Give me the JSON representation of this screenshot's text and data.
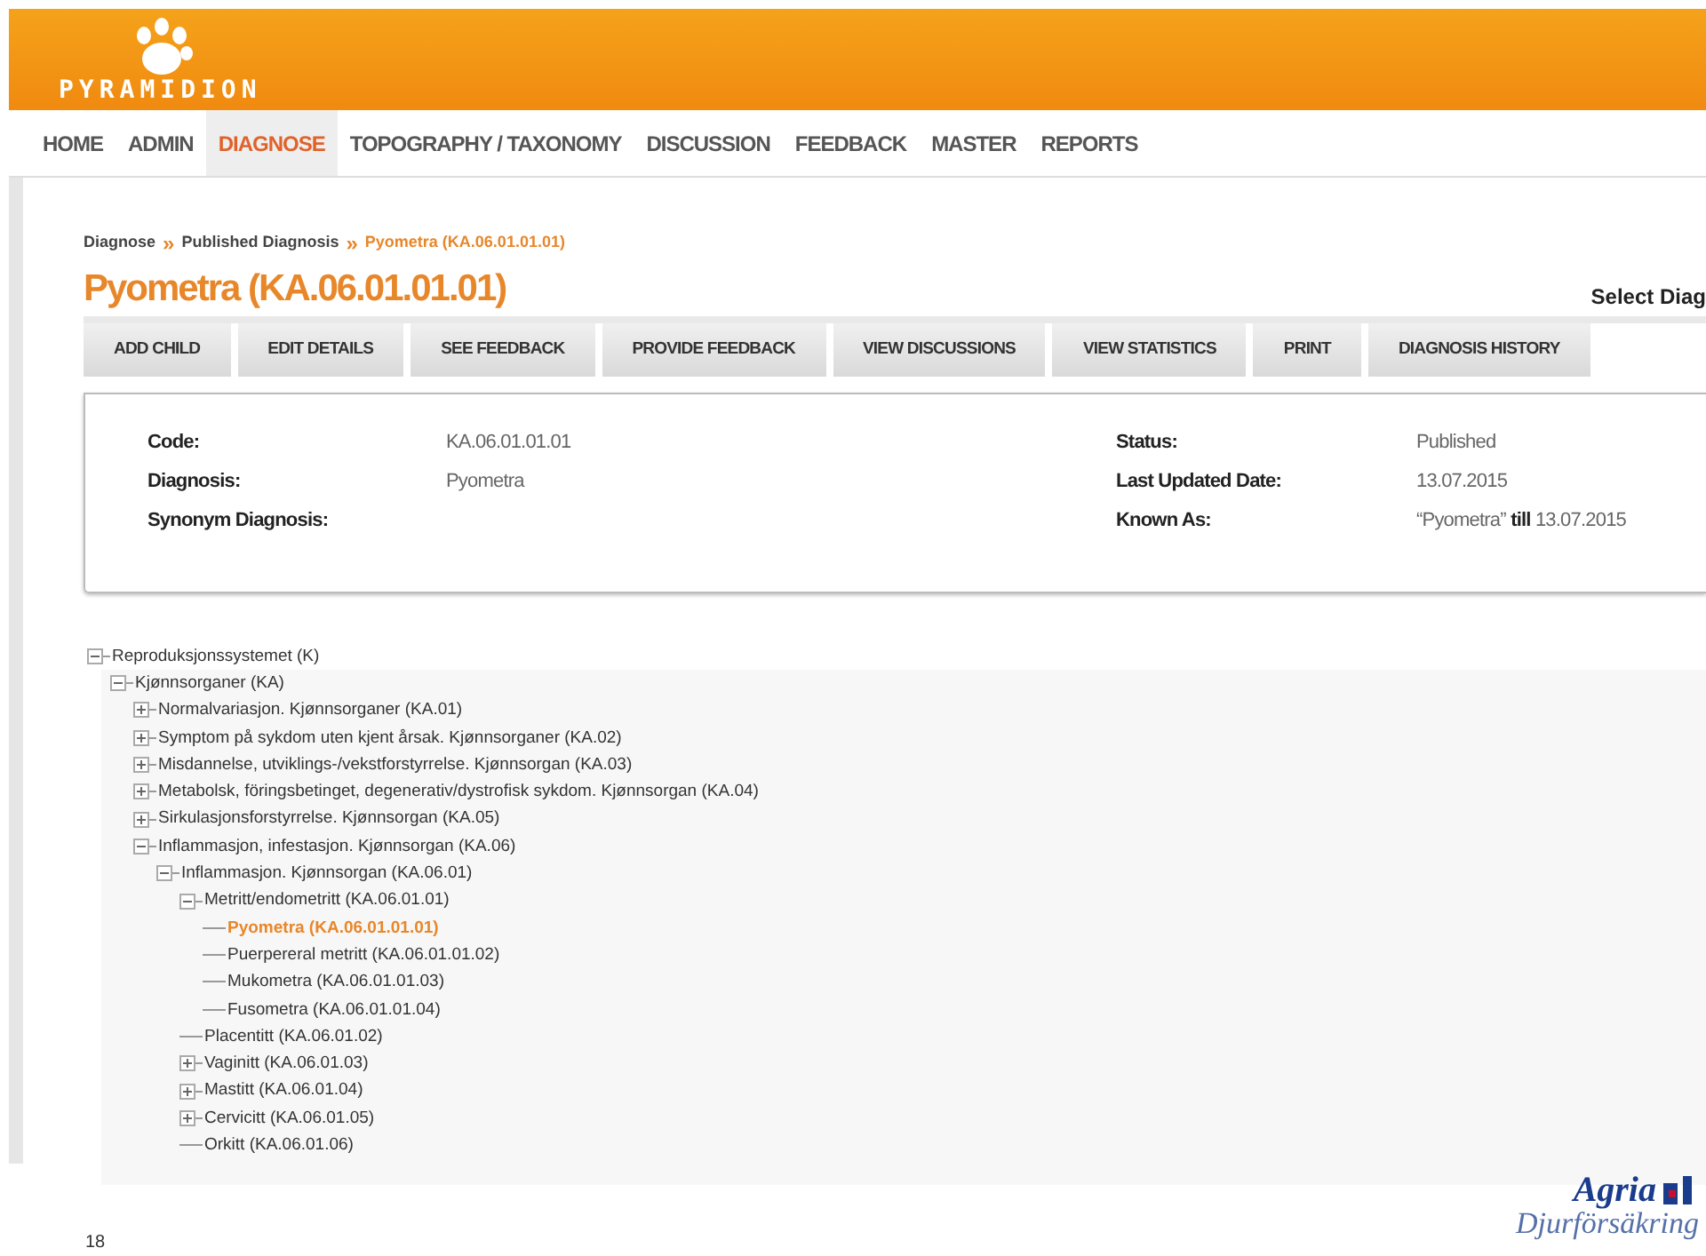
{
  "header": {
    "logo_text": "PYRAMIDION"
  },
  "nav": [
    {
      "label": "HOME",
      "selected": false
    },
    {
      "label": "ADMIN",
      "selected": false
    },
    {
      "label": "DIAGNOSE",
      "selected": true
    },
    {
      "label": "TOPOGRAPHY / TAXONOMY",
      "selected": false
    },
    {
      "label": "DISCUSSION",
      "selected": false
    },
    {
      "label": "FEEDBACK",
      "selected": false
    },
    {
      "label": "MASTER",
      "selected": false
    },
    {
      "label": "REPORTS",
      "selected": false
    }
  ],
  "breadcrumb": [
    {
      "label": "Diagnose",
      "selected": false
    },
    {
      "label": "Published Diagnosis",
      "selected": false
    },
    {
      "label": "Pyometra (KA.06.01.01.01)",
      "selected": true
    }
  ],
  "breadcrumb_separator": "»",
  "title": "Pyometra (KA.06.01.01.01)",
  "select_label": "Select Diag",
  "actions": [
    "ADD CHILD",
    "EDIT DETAILS",
    "SEE FEEDBACK",
    "PROVIDE FEEDBACK",
    "VIEW DISCUSSIONS",
    "VIEW STATISTICS",
    "PRINT",
    "DIAGNOSIS HISTORY"
  ],
  "details_left": [
    {
      "label": "Code:",
      "value": "KA.06.01.01.01"
    },
    {
      "label": "Diagnosis:",
      "value": "Pyometra"
    },
    {
      "label": "Synonym Diagnosis:"
    }
  ],
  "details_right": [
    {
      "label": "Status:",
      "value": "Published"
    },
    {
      "label": "Last Updated Date:",
      "value": "13.07.2015"
    },
    {
      "label": "Known As:",
      "value": "“Pyometra” **till** 13.07.2015"
    }
  ],
  "tree": [
    {
      "label": "Reproduksjonssystemet (K)",
      "kind": "branch",
      "expanded": true,
      "selected": false,
      "children": [
        {
          "label": "Kjønnsorganer (KA)",
          "kind": "branch",
          "expanded": true,
          "selected": false,
          "children": [
            {
              "label": "Normalvariasjon. Kjønnsorganer (KA.01)",
              "kind": "branch",
              "expanded": false,
              "selected": false
            },
            {
              "label": "Symptom på sykdom uten kjent årsak. Kjønnsorganer (KA.02)",
              "kind": "branch",
              "expanded": false,
              "selected": false
            },
            {
              "label": "Misdannelse, utviklings-/vekstforstyrrelse. Kjønnsorgan (KA.03)",
              "kind": "branch",
              "expanded": false,
              "selected": false
            },
            {
              "label": "Metabolsk, föringsbetinget, degenerativ/dystrofisk sykdom. Kjønnsorgan (KA.04)",
              "kind": "branch",
              "expanded": false,
              "selected": false
            },
            {
              "label": "Sirkulasjonsforstyrrelse. Kjønnsorgan (KA.05)",
              "kind": "branch",
              "expanded": false,
              "selected": false
            },
            {
              "label": "Inflammasjon, infestasjon. Kjønnsorgan (KA.06)",
              "kind": "branch",
              "expanded": true,
              "selected": false,
              "children": [
                {
                  "label": "Inflammasjon. Kjønnsorgan (KA.06.01)",
                  "kind": "branch",
                  "expanded": true,
                  "selected": false,
                  "children": [
                    {
                      "label": "Metritt/endometritt (KA.06.01.01)",
                      "kind": "branch",
                      "expanded": true,
                      "selected": false,
                      "children": [
                        {
                          "label": "Pyometra (KA.06.01.01.01)",
                          "kind": "leaf",
                          "selected": true
                        },
                        {
                          "label": "Puerpereral metritt (KA.06.01.01.02)",
                          "kind": "leaf",
                          "selected": false
                        },
                        {
                          "label": "Mukometra (KA.06.01.01.03)",
                          "kind": "leaf",
                          "selected": false
                        },
                        {
                          "label": "Fusometra (KA.06.01.01.04)",
                          "kind": "leaf",
                          "selected": false
                        }
                      ]
                    },
                    {
                      "label": "Placentitt (KA.06.01.02)",
                      "kind": "leaf",
                      "selected": false
                    },
                    {
                      "label": "Vaginitt (KA.06.01.03)",
                      "kind": "branch",
                      "expanded": false,
                      "selected": false
                    },
                    {
                      "label": "Mastitt (KA.06.01.04)",
                      "kind": "branch",
                      "expanded": false,
                      "selected": false
                    },
                    {
                      "label": "Cervicitt (KA.06.01.05)",
                      "kind": "branch",
                      "expanded": false,
                      "selected": false
                    },
                    {
                      "label": "Orkitt (KA.06.01.06)",
                      "kind": "leaf",
                      "selected": false
                    }
                  ]
                }
              ]
            }
          ]
        }
      ]
    }
  ],
  "slide": {
    "page_number": "18",
    "logo_text": "Agria",
    "logo_subtitle": "Djurförsäkring"
  }
}
